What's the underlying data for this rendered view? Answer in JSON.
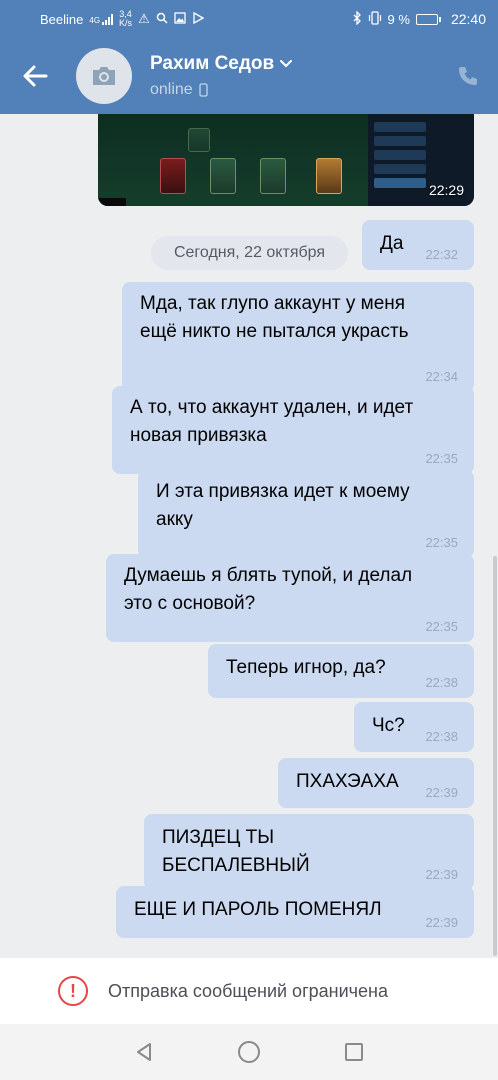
{
  "status_bar": {
    "carrier": "Beeline",
    "network": "4G",
    "speed_value": "3,4",
    "speed_unit": "K/s",
    "battery_text": "9 %",
    "battery_level": 0.09,
    "clock": "22:40"
  },
  "header": {
    "contact_name": "Рахим Седов",
    "status": "online"
  },
  "photo_message": {
    "time": "22:29"
  },
  "date_separator": "Сегодня, 22 октября",
  "messages": [
    {
      "lines": [
        "Да"
      ],
      "time": "22:32"
    },
    {
      "lines": [
        "Мда, так глупо аккаунт у меня",
        "ещё никто не пытался украсть"
      ],
      "time": "22:34"
    },
    {
      "lines": [
        "А то, что аккаунт удален, и идет",
        "новая привязка"
      ],
      "time": "22:35"
    },
    {
      "lines": [
        "И эта привязка идет к моему",
        "акку"
      ],
      "time": "22:35"
    },
    {
      "lines": [
        "Думаешь я блять тупой, и делал",
        "это с основой?"
      ],
      "time": "22:35"
    },
    {
      "lines": [
        "Теперь игнор, да?"
      ],
      "time": "22:38"
    },
    {
      "lines": [
        "Чс?"
      ],
      "time": "22:38"
    },
    {
      "lines": [
        "ПХАХЭАХА"
      ],
      "time": "22:39"
    },
    {
      "lines": [
        "ПИЗДЕЦ ТЫ БЕСПАЛЕВНЫЙ"
      ],
      "time": "22:39"
    },
    {
      "lines": [
        "ЕЩЕ И ПАРОЛЬ ПОМЕНЯЛ"
      ],
      "time": "22:39"
    }
  ],
  "restriction_notice": "Отправка сообщений ограничена",
  "colors": {
    "header_blue": "#5181b8",
    "bubble_out": "#cbdaf0",
    "chat_background": "#edeef0",
    "warning_red": "#e64646"
  },
  "icons": [
    "back-arrow-icon",
    "camera-icon",
    "chevron-down-icon",
    "phone-small-icon",
    "call-icon",
    "warning-icon",
    "nav-back-icon",
    "nav-home-icon",
    "nav-recents-icon"
  ]
}
